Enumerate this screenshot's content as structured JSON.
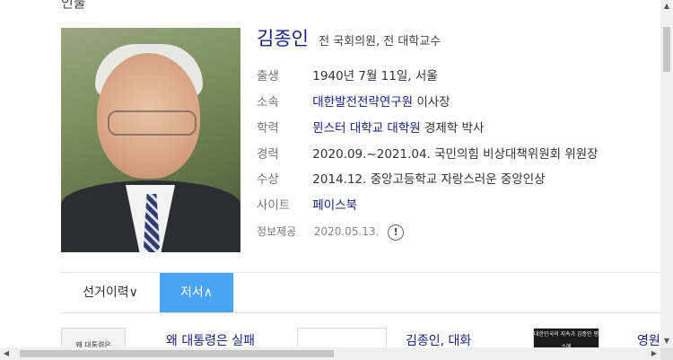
{
  "section": {
    "label": "인물"
  },
  "profile": {
    "name": "김종인",
    "description": "전 국회의원, 전 대학교수",
    "rows": [
      {
        "key": "출생",
        "value": "1940년 7월 11일, 서울"
      },
      {
        "key": "소속",
        "value_link": "대한발전전략연구원",
        "value": "이사장"
      },
      {
        "key": "학력",
        "value_link": "뮌스터 대학교 대학원",
        "value": "경제학 박사"
      },
      {
        "key": "경력",
        "value": "2020.09.~2021.04. 국민의힘 비상대책위원회 위원장"
      },
      {
        "key": "수상",
        "value": "2014.12. 중앙고등학교 자랑스러운 중앙인상"
      },
      {
        "key": "사이트",
        "value_link": "페이스북"
      }
    ],
    "source": {
      "key": "정보제공",
      "date": "2020.05.13.",
      "icon": "!"
    }
  },
  "tabs": [
    {
      "label": "선거이력",
      "icon": "∨"
    },
    {
      "label": "저서",
      "icon": "∧"
    }
  ],
  "books": [
    {
      "title": "왜 대통령은 실패",
      "thumb_text": "왜 대통령은"
    },
    {
      "title": "김종인, 대화"
    },
    {
      "title": "영원",
      "thumb_text": "대한민국의 지속가 김종인 평소에"
    }
  ],
  "colors": {
    "accent": "#4aa4f5",
    "link": "#1a237e"
  }
}
